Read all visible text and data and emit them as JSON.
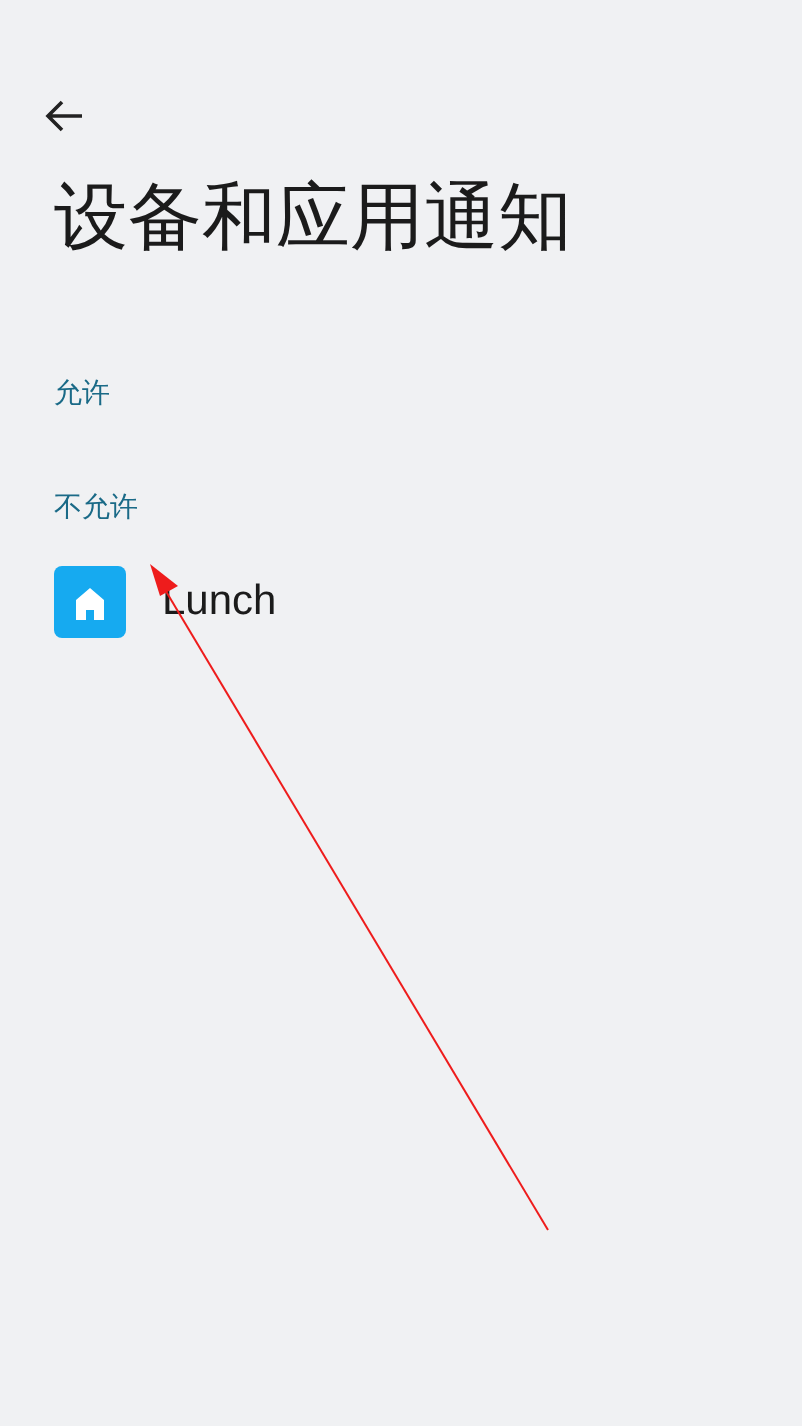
{
  "title": "设备和应用通知",
  "sections": [
    {
      "header": "允许"
    },
    {
      "header": "不允许",
      "apps": [
        {
          "name": "Lunch"
        }
      ]
    }
  ]
}
